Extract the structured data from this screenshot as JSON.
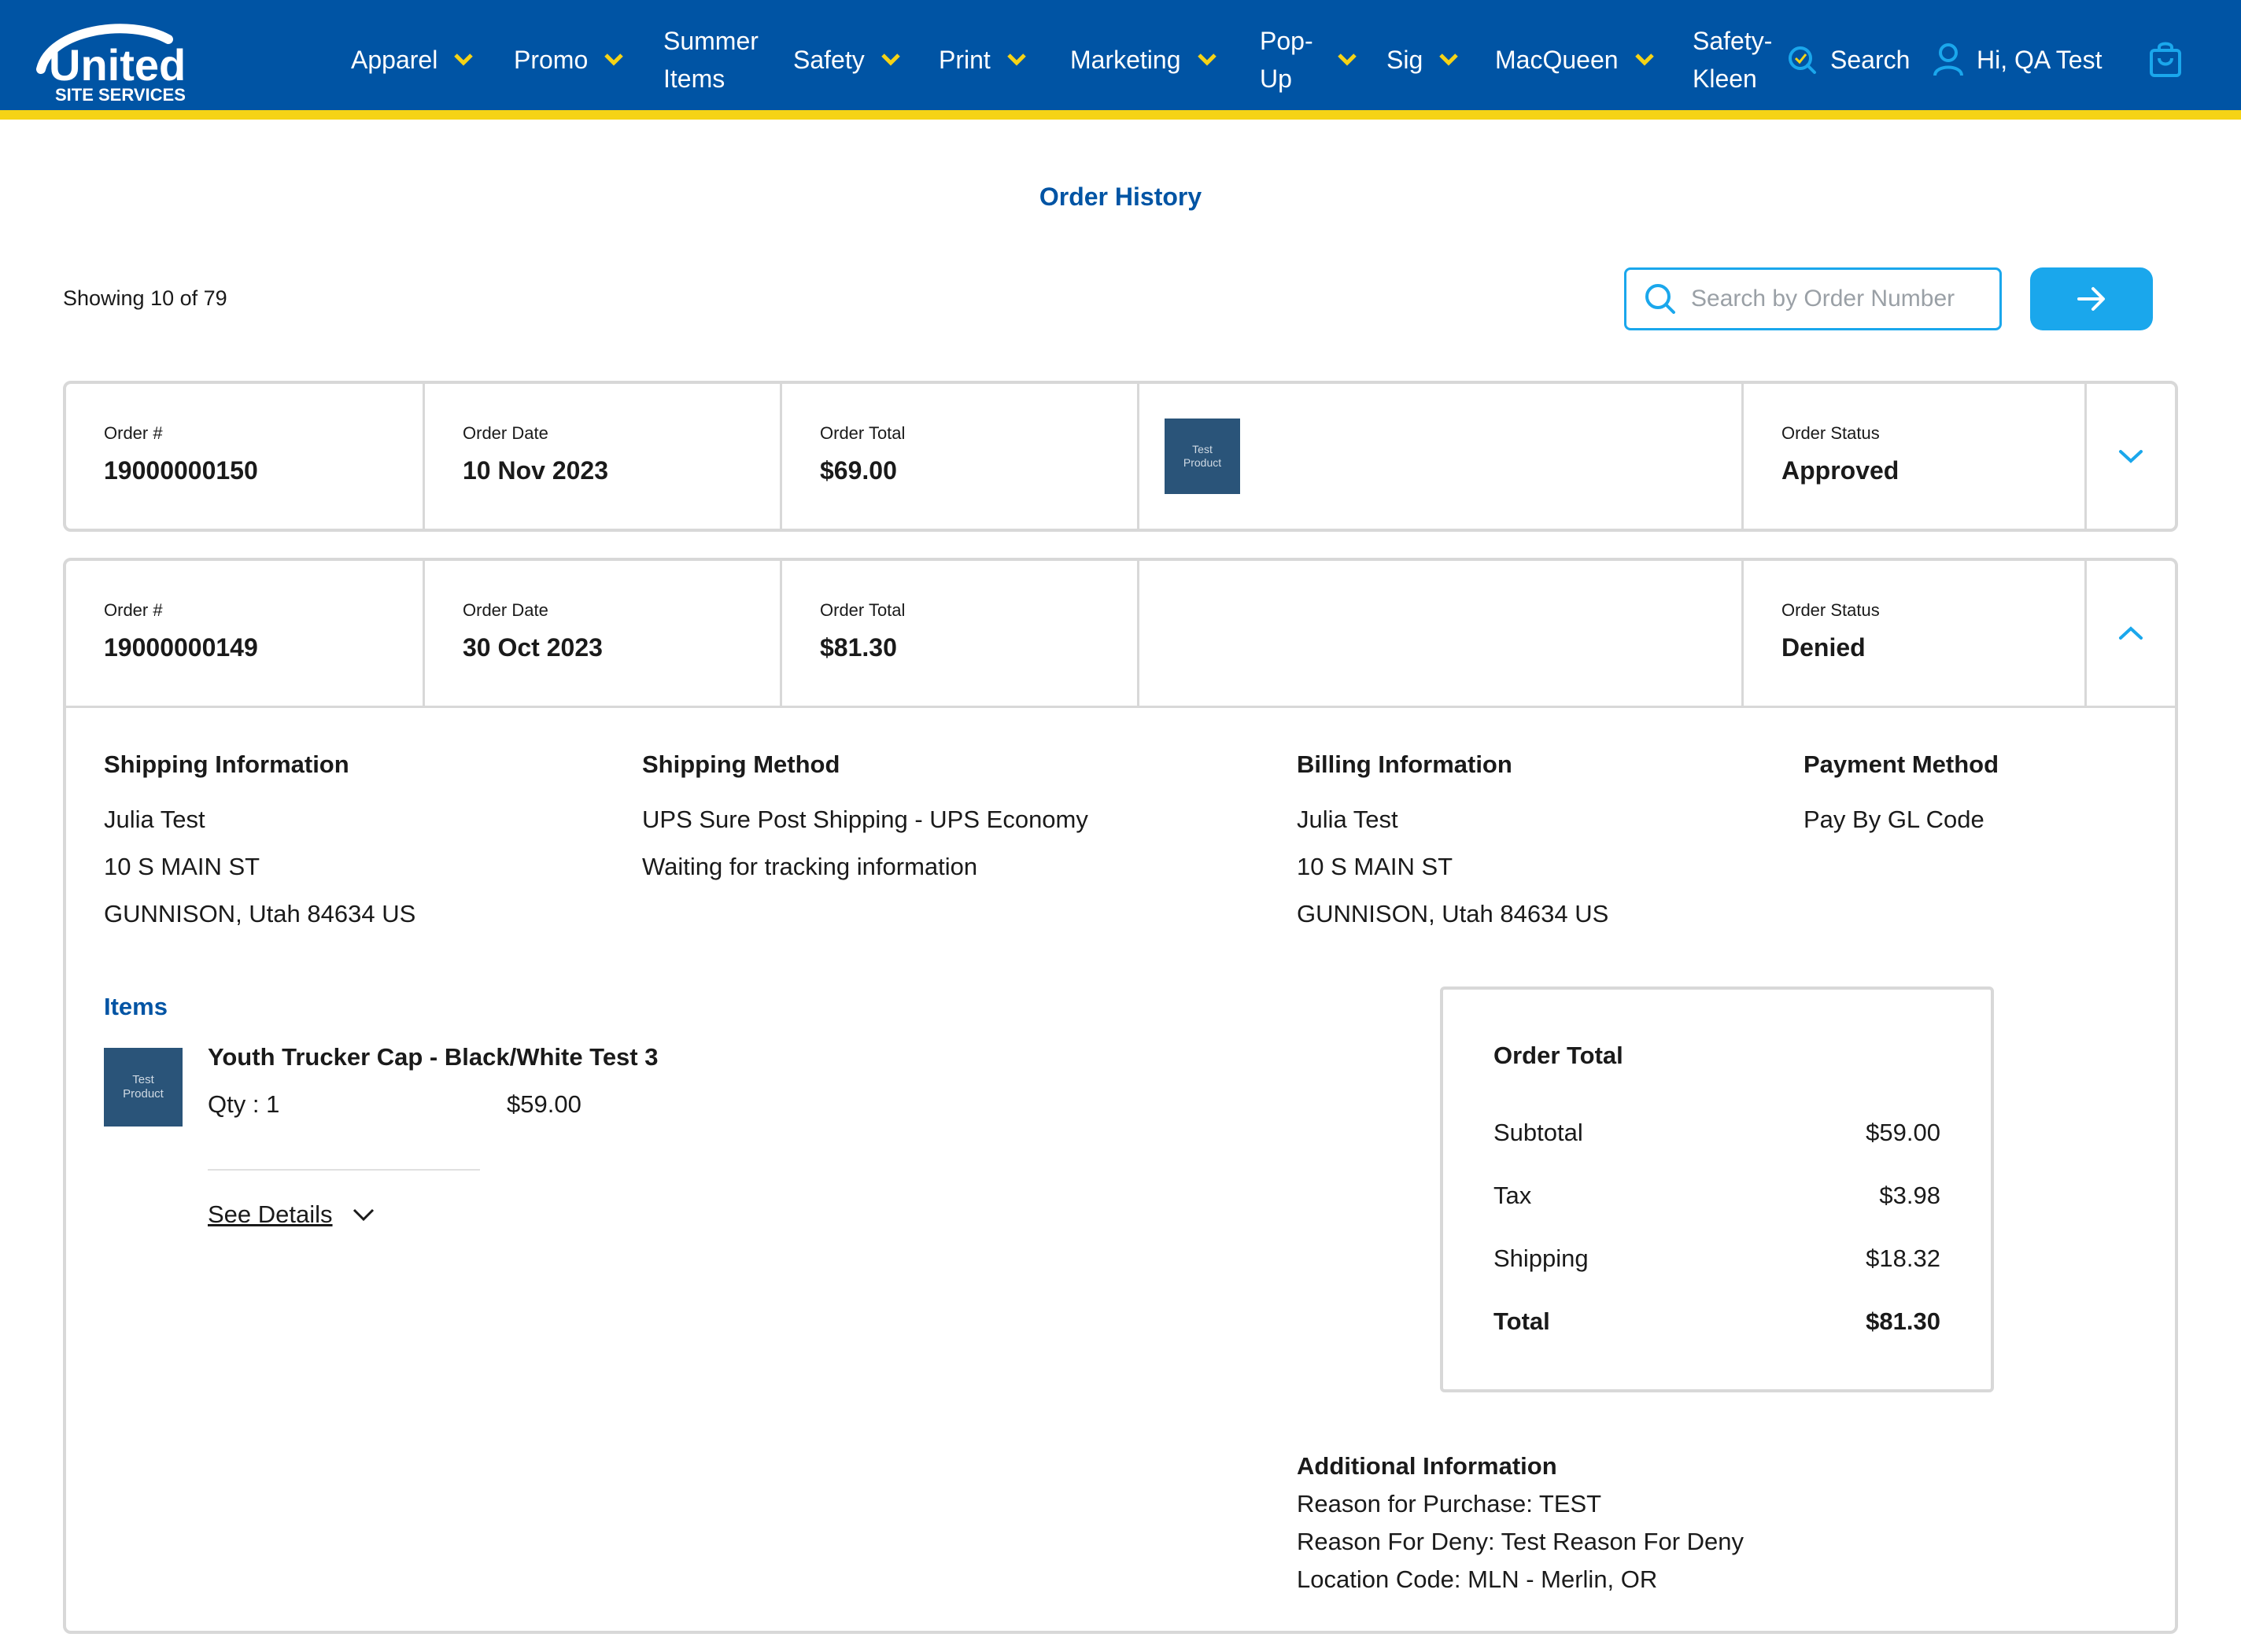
{
  "brand": {
    "logo_top": "United",
    "logo_bottom": "SITE SERVICES",
    "nav_color": "#0054a4",
    "accent_color": "#f5d316",
    "link_color": "#1aa7ec"
  },
  "nav": {
    "items": [
      {
        "label": "Apparel",
        "has_chevron": true
      },
      {
        "label": "Promo",
        "has_chevron": true
      },
      {
        "label": "Summer Items",
        "line1": "Summer",
        "line2": "Items",
        "has_chevron": false
      },
      {
        "label": "Safety",
        "has_chevron": true
      },
      {
        "label": "Print",
        "has_chevron": true
      },
      {
        "label": "Marketing",
        "has_chevron": true
      },
      {
        "label": "Pop-Up",
        "line1": "Pop-",
        "line2": "Up",
        "has_chevron": true
      },
      {
        "label": "Sig",
        "has_chevron": true
      },
      {
        "label": "MacQueen",
        "has_chevron": true
      },
      {
        "label": "Safety-Kleen",
        "line1": "Safety-",
        "line2": "Kleen",
        "has_chevron": false
      }
    ],
    "search_label": "Search",
    "user_label": "Hi, QA Test",
    "cart_icon": "cart-icon"
  },
  "page": {
    "title": "Order History",
    "showing": "Showing 10 of 79",
    "search_placeholder": "Search by Order Number"
  },
  "labels": {
    "order_number": "Order #",
    "order_date": "Order Date",
    "order_total": "Order Total",
    "order_status": "Order Status",
    "product_thumb_line1": "Test",
    "product_thumb_line2": "Product"
  },
  "orders": [
    {
      "number": "19000000150",
      "date": "10 Nov 2023",
      "total": "$69.00",
      "status": "Approved",
      "expanded": false
    },
    {
      "number": "19000000149",
      "date": "30 Oct 2023",
      "total": "$81.30",
      "status": "Denied",
      "expanded": true,
      "shipping_info": {
        "heading": "Shipping Information",
        "name": "Julia Test",
        "street": "10 S MAIN ST",
        "city": "GUNNISON, Utah 84634 US"
      },
      "shipping_method": {
        "heading": "Shipping Method",
        "method": "UPS Sure Post Shipping - UPS Economy",
        "tracking": "Waiting for tracking information"
      },
      "billing_info": {
        "heading": "Billing Information",
        "name": "Julia Test",
        "street": "10 S MAIN ST",
        "city": "GUNNISON, Utah 84634 US"
      },
      "payment_method": {
        "heading": "Payment Method",
        "method": "Pay By GL Code"
      },
      "items_heading": "Items",
      "items": [
        {
          "name": "Youth Trucker Cap - Black/White Test 3",
          "qty": "Qty : 1",
          "price": "$59.00",
          "see_details": "See Details"
        }
      ],
      "totals": {
        "heading": "Order Total",
        "subtotal_label": "Subtotal",
        "subtotal": "$59.00",
        "tax_label": "Tax",
        "tax": "$3.98",
        "shipping_label": "Shipping",
        "shipping": "$18.32",
        "total_label": "Total",
        "total": "$81.30"
      },
      "additional": {
        "heading": "Additional Information",
        "reason_purchase": "Reason for Purchase: TEST",
        "reason_deny": "Reason For Deny: Test Reason For Deny",
        "location": "Location Code: MLN - Merlin, OR"
      }
    }
  ]
}
